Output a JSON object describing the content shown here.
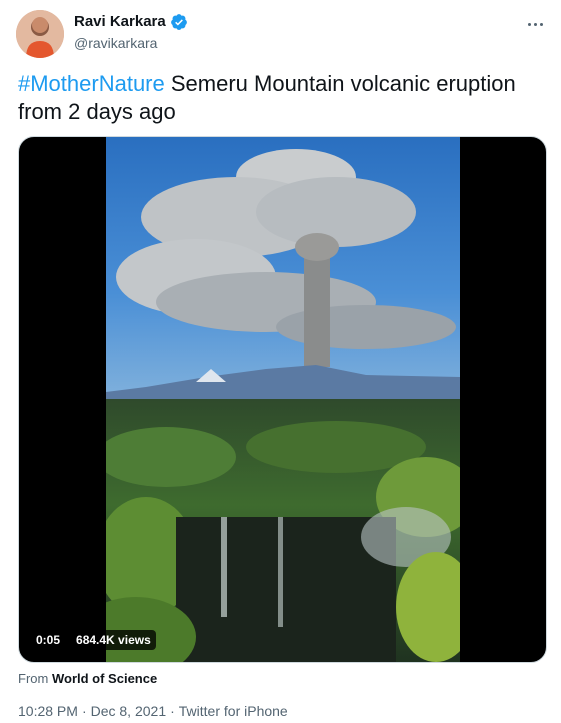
{
  "author": {
    "display_name": "Ravi Karkara",
    "handle": "@ravikarkara",
    "verified": true
  },
  "tweet": {
    "hashtag": "#MotherNature",
    "text": " Semeru Mountain volcanic eruption from 2 days ago"
  },
  "video": {
    "elapsed": "0:05",
    "views": "684.4K views"
  },
  "source": {
    "prefix": "From",
    "name": "World of Science"
  },
  "meta": {
    "time": "10:28 PM",
    "date": "Dec 8, 2021",
    "client": "Twitter for iPhone",
    "separator": "·"
  },
  "colors": {
    "accent": "#1d9bf0",
    "secondary_text": "#536471"
  }
}
